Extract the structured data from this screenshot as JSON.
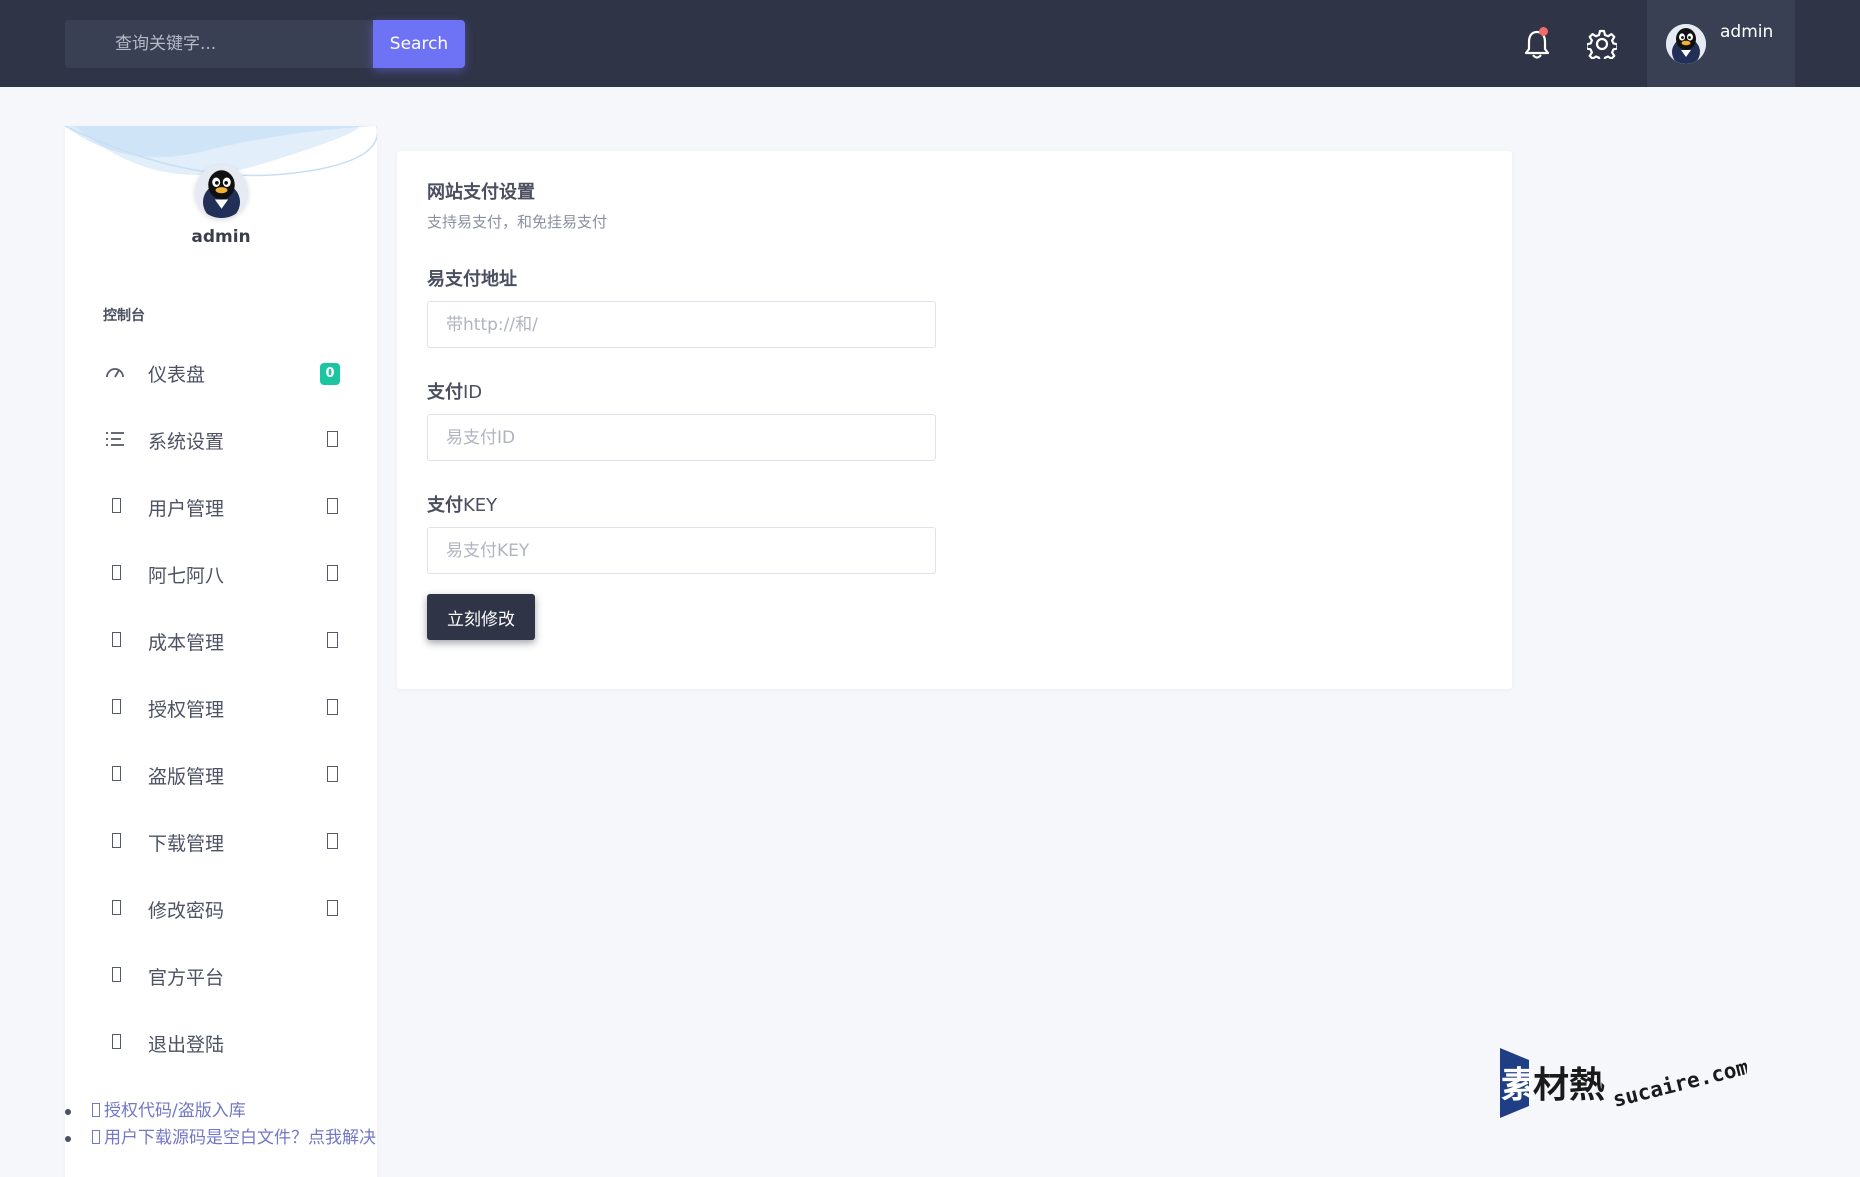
{
  "header": {
    "search_placeholder": "查询关键字...",
    "search_button": "Search",
    "user_name": "admin"
  },
  "sidebar": {
    "profile_name": "admin",
    "section_title": "控制台",
    "items": [
      {
        "label": "仪表盘",
        "icon": "dashboard-gauge-icon",
        "badge": "0"
      },
      {
        "label": "系统设置",
        "icon": "list-icon"
      },
      {
        "label": "用户管理",
        "icon": "missing-glyph-icon"
      },
      {
        "label": "阿七阿八",
        "icon": "missing-glyph-icon"
      },
      {
        "label": "成本管理",
        "icon": "missing-glyph-icon"
      },
      {
        "label": "授权管理",
        "icon": "missing-glyph-icon"
      },
      {
        "label": "盗版管理",
        "icon": "missing-glyph-icon"
      },
      {
        "label": "下载管理",
        "icon": "missing-glyph-icon"
      },
      {
        "label": "修改密码",
        "icon": "missing-glyph-icon"
      },
      {
        "label": "官方平台",
        "icon": "missing-glyph-icon"
      },
      {
        "label": "退出登陆",
        "icon": "missing-glyph-icon"
      }
    ],
    "links": [
      "授权代码/盗版入库",
      "用户下载源码是空白文件？点我解决"
    ]
  },
  "card": {
    "title": "网站支付设置",
    "subtitle": "支持易支付，和免挂易支付",
    "fields": [
      {
        "label_bold": "易支付地址",
        "label_rest": "",
        "placeholder": "带http://和/",
        "value": ""
      },
      {
        "label_bold": "支付",
        "label_rest": "ID",
        "placeholder": "易支付ID",
        "value": ""
      },
      {
        "label_bold": "支付",
        "label_rest": "KEY",
        "placeholder": "易支付KEY",
        "value": ""
      }
    ],
    "submit_label": "立刻修改"
  },
  "watermark": {
    "brand": "素材熱",
    "domain": "sucaire.com"
  },
  "colors": {
    "topbar": "#2f3447",
    "accent": "#6e73f5",
    "badge": "#1bc5a0",
    "link": "#7277c7",
    "background": "#f6f7fb"
  }
}
